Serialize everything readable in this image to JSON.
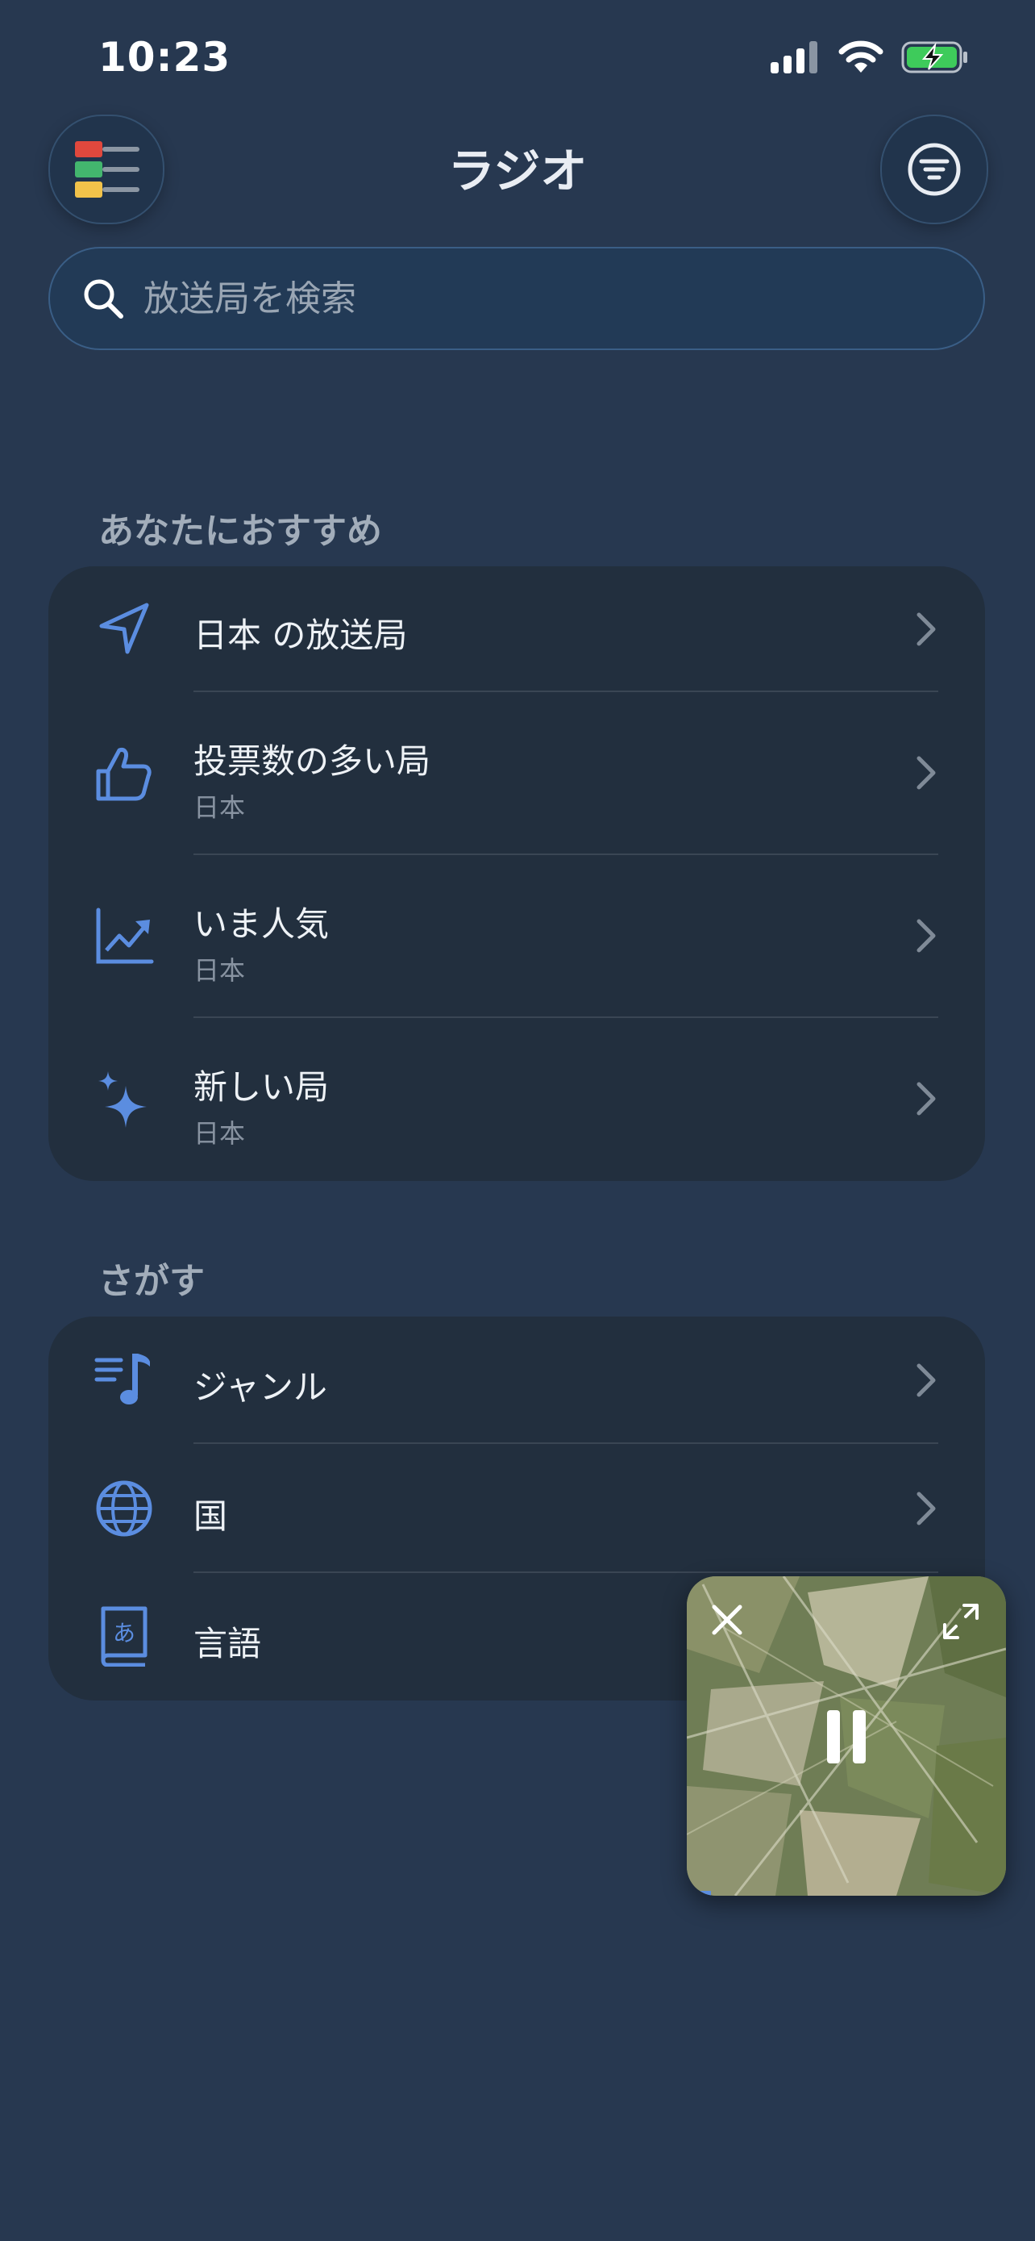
{
  "status_bar": {
    "time": "10:23"
  },
  "header": {
    "title": "ラジオ"
  },
  "search": {
    "placeholder": "放送局を検索"
  },
  "recommended": {
    "title": "あなたにおすすめ",
    "items": [
      {
        "label": "日本 の放送局",
        "sub": "",
        "icon": "location-arrow-icon"
      },
      {
        "label": "投票数の多い局",
        "sub": "日本",
        "icon": "thumbs-up-icon"
      },
      {
        "label": "いま人気",
        "sub": "日本",
        "icon": "trending-chart-icon"
      },
      {
        "label": "新しい局",
        "sub": "日本",
        "icon": "sparkles-icon"
      }
    ]
  },
  "browse": {
    "title": "さがす",
    "items": [
      {
        "label": "ジャンル",
        "icon": "music-list-icon"
      },
      {
        "label": "国",
        "icon": "globe-icon"
      },
      {
        "label": "言語",
        "icon": "language-book-icon"
      }
    ]
  },
  "colors": {
    "background": "#273850",
    "card": "#222f3e",
    "accent": "#5b8de0"
  }
}
